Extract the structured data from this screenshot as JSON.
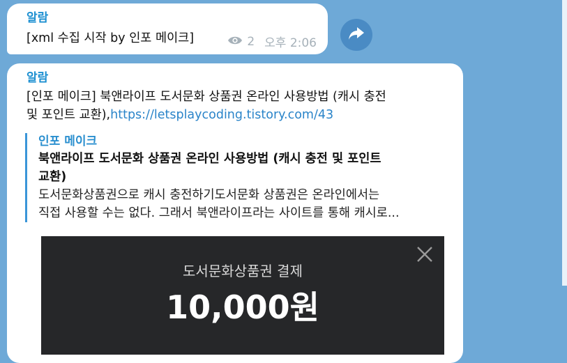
{
  "messages": [
    {
      "sender": "알람",
      "text": "[xml 수집 시작 by 인포 메이크]",
      "views": "2",
      "time": "오후 2:06"
    },
    {
      "sender": "알람",
      "text_line1": "[인포 메이크] 북앤라이프 도서문화 상품권 온라인 사용방법 (캐시 충전",
      "text_line2_prefix": "및 포인트 교환),",
      "link": "https://letsplaycoding.tistory.com/43",
      "preview": {
        "site": "인포 메이크",
        "title_line1": "북앤라이프 도서문화 상품권 온라인 사용방법 (캐시 충전 및 포인트",
        "title_line2": "교환)",
        "desc_line1": "도서문화상품권으로 캐시 충전하기도서문화 상품권은 온라인에서는",
        "desc_line2": "직접 사용할 수는 없다. 그래서 북앤라이프라는 사이트를 통해 캐시로...",
        "image": {
          "caption": "도서문화상품권 결제",
          "amount": "10,000원"
        }
      }
    }
  ],
  "icons": {
    "views": "eye-icon",
    "forward": "share-arrow-icon",
    "close": "close-icon"
  },
  "colors": {
    "background": "#6ea9d7",
    "sender": "#1c8fd1",
    "link": "#2a84c9",
    "forward_button": "#4a8bc4"
  }
}
